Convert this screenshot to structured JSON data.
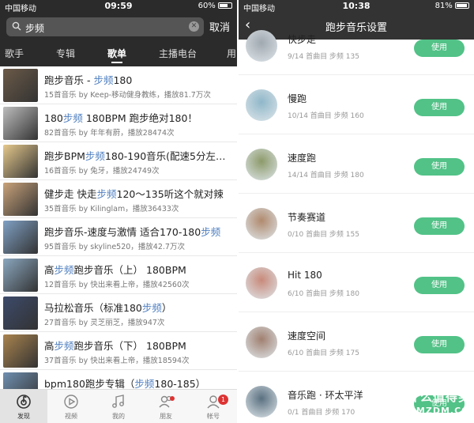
{
  "left": {
    "status": {
      "carrier": "中国移动",
      "time": "09:59",
      "battery": "60%"
    },
    "search": {
      "query": "步频",
      "cancel": "取消"
    },
    "tabs": [
      {
        "label": "歌手"
      },
      {
        "label": "专辑"
      },
      {
        "label": "歌单",
        "active": true
      },
      {
        "label": "主播电台"
      },
      {
        "label": "用"
      }
    ],
    "results": [
      {
        "pre": "跑步音乐 - ",
        "hl": "步频",
        "post": "180",
        "sub": "15首音乐  by Keep-移动健身教练，播放81.7万次",
        "thumb_color": "#6b5a48"
      },
      {
        "pre": "180",
        "hl": "步频",
        "post": " 180BPM 跑步绝对180！",
        "sub": "82首音乐  by 年年有蔚，播放28474次",
        "thumb_color": "#bdbdbd"
      },
      {
        "pre": "跑步BPM",
        "hl": "步频",
        "post": "180-190音乐(配速5分左…",
        "sub": "16首音乐  by 兔牙，播放24749次",
        "thumb_color": "#e6c98c"
      },
      {
        "pre": "健步走 快走",
        "hl": "步频",
        "post": "120～135听这个就对辣",
        "sub": "35首音乐  by Kilinglam，播放36433次",
        "thumb_color": "#c9a27a"
      },
      {
        "pre": "跑步音乐-速度与激情 适合170-180",
        "hl": "步频",
        "post": "",
        "sub": "95首音乐  by skyline520，播放42.7万次",
        "thumb_color": "#7fa0c4"
      },
      {
        "pre": "高",
        "hl": "步频",
        "post": "跑步音乐（上） 180BPM",
        "sub": "12首音乐  by 快出来看上帝，播放42560次",
        "thumb_color": "#8aa7bf"
      },
      {
        "pre": "马拉松音乐（标准180",
        "hl": "步频",
        "post": "）",
        "sub": "27首音乐  by 灵芝丽芝，播放947次",
        "thumb_color": "#3c4a6a"
      },
      {
        "pre": "高",
        "hl": "步频",
        "post": "跑步音乐（下） 180BPM",
        "sub": "37首音乐  by 快出来看上帝，播放18594次",
        "thumb_color": "#a9834e"
      },
      {
        "pre": "bpm180跑步专辑（",
        "hl": "步频",
        "post": "180-185）",
        "sub": "",
        "thumb_color": "#6f8fb0"
      }
    ],
    "nav": [
      {
        "label": "发现",
        "icon": "discover-icon",
        "active": true
      },
      {
        "label": "视频",
        "icon": "video-icon"
      },
      {
        "label": "我的",
        "icon": "music-note-icon"
      },
      {
        "label": "朋友",
        "icon": "friends-icon",
        "dot": true
      },
      {
        "label": "帐号",
        "icon": "account-icon",
        "badge": "1"
      }
    ]
  },
  "right": {
    "status": {
      "carrier": "中国移动",
      "time": "10:38",
      "battery": "81%"
    },
    "title": "跑步音乐设置",
    "button_label": "使用",
    "playlists": [
      {
        "name": "快步走",
        "sub": "9/14 首曲目 步频 135",
        "color": "#a0a8b0"
      },
      {
        "name": "慢跑",
        "sub": "10/14 首曲目 步频 160",
        "color": "#8fb7c9"
      },
      {
        "name": "速度跑",
        "sub": "14/14 首曲目 步频 180",
        "color": "#8c9a6a"
      },
      {
        "name": "节奏赛道",
        "sub": "0/10 首曲目 步频 155",
        "color": "#b08a6e"
      },
      {
        "name": "Hit 180",
        "sub": "6/10 首曲目 步频 180",
        "color": "#c88a7a"
      },
      {
        "name": "速度空间",
        "sub": "6/10 首曲目 步频 175",
        "color": "#a08070"
      },
      {
        "name": "音乐跑 · 环太平洋",
        "sub": "0/1 首曲目 步频 170",
        "color": "#5a7080"
      }
    ],
    "watermark": {
      "line1": "什么值得买",
      "line2": "SMZDM.COM",
      "glyph": "值"
    }
  }
}
